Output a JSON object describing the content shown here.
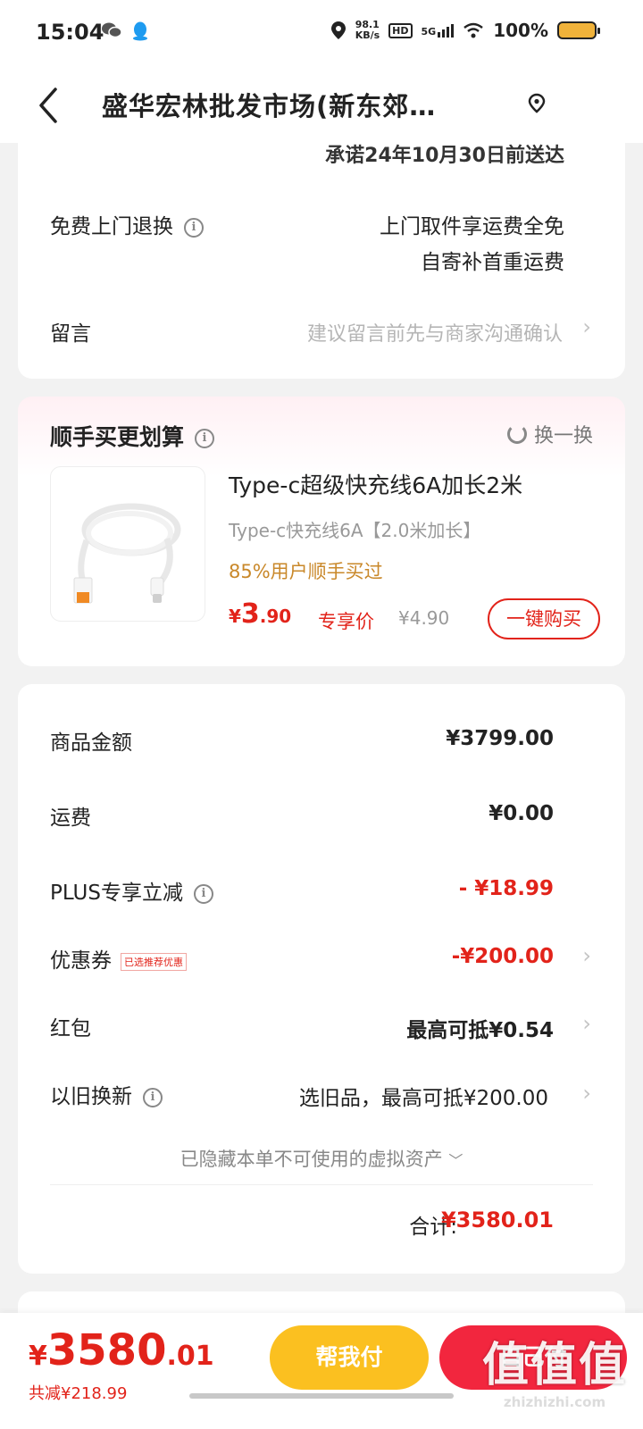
{
  "status_bar": {
    "time": "15:04",
    "net_speed_value": "98.1",
    "net_speed_unit": "KB/s",
    "hd_badge": "HD",
    "signal_label": "5G",
    "battery_percent": "100%"
  },
  "header": {
    "title": "盛华宏林批发市场(新东郊…"
  },
  "order_info": {
    "delivery_promise": "承诺24年10月30日前送达",
    "return_label": "免费上门退换",
    "return_line1": "上门取件享运费全免",
    "return_line2": "自寄补首重运费",
    "message_label": "留言",
    "message_placeholder": "建议留言前先与商家沟通确认"
  },
  "upsell": {
    "title": "顺手买更划算",
    "swap_label": "换一换",
    "product": {
      "name": "Type-c超级快充线6A加长2米",
      "spec": "Type-c快充线6A【2.0米加长】",
      "social_proof": "85%用户顺手买过",
      "price_currency": "¥",
      "price_int": "3",
      "price_dec": ".90",
      "price_tag": "专享价",
      "original_price": "¥4.90",
      "buy_label": "一键购买"
    }
  },
  "fees": {
    "goods_label": "商品金额",
    "goods_value": "¥3799.00",
    "shipping_label": "运费",
    "shipping_value": "¥0.00",
    "plus_label": "PLUS专享立减",
    "plus_value": "- ¥18.99",
    "coupon_label": "优惠券",
    "coupon_tag": "已选推荐优惠",
    "coupon_value": "-¥200.00",
    "redpacket_label": "红包",
    "redpacket_value": "最高可抵¥0.54",
    "tradein_label": "以旧换新",
    "tradein_value": "选旧品，最高可抵¥200.00",
    "hidden_assets": "已隐藏本单不可使用的虚拟资产",
    "total_label": "合计:",
    "total_value": "¥3580.01"
  },
  "bottom_bar": {
    "price_currency": "¥",
    "price_int": "3580",
    "price_dec": ".01",
    "saved": "共减¥218.99",
    "help_pay_label": "帮我付",
    "self_pay_label": "自己付"
  },
  "watermark": {
    "logo_text": "值值值",
    "url": "zhizhizhi.com"
  },
  "colors": {
    "accent_red": "#e2231a",
    "pay_red": "#f2263e",
    "help_yellow": "#fbc020",
    "social_orange": "#c9882a"
  }
}
